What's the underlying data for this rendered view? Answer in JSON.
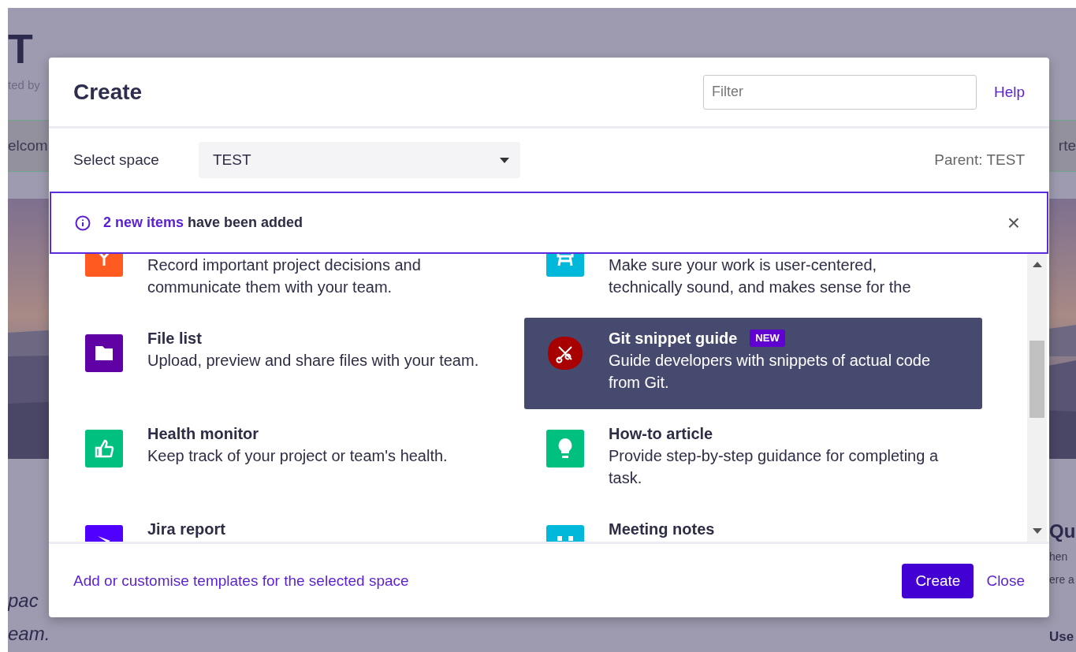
{
  "background_page": {
    "title": "T",
    "byline": "ted by",
    "nav": [
      "elcom",
      "rte"
    ],
    "left_text": [
      "pac",
      "eam."
    ],
    "right_heading": "Qu",
    "right_text": [
      "hen",
      "ere a"
    ],
    "right_heading_2": "Use"
  },
  "dialog": {
    "title": "Create",
    "filter": {
      "placeholder": "Filter"
    },
    "help": "Help",
    "space": {
      "label": "Select space",
      "value": "TEST",
      "parent": "Parent: TEST"
    },
    "banner": {
      "highlight": "2 new items",
      "text": " have been added",
      "close": "×"
    },
    "templates": [
      {
        "kind": "decision",
        "color": "#ff5a1f",
        "description": "Record important project decisions and communicate them with your team.",
        "selected": false
      },
      {
        "kind": "design",
        "color": "#00b8d9",
        "description": "Make sure your work is user-centered, technically sound, and makes sense for the",
        "selected": false
      },
      {
        "kind": "folder",
        "color": "#6001a6",
        "title": "File list",
        "description": "Upload, preview and share files with your team.",
        "selected": false
      },
      {
        "kind": "git",
        "color": "#a80000",
        "title": "Git snippet guide",
        "badge": "NEW",
        "description": "Guide developers with snippets of actual code from Git.",
        "selected": true
      },
      {
        "kind": "health",
        "color": "#00c07f",
        "title": "Health monitor",
        "description": "Keep track of your project or team's health.",
        "selected": false
      },
      {
        "kind": "howto",
        "color": "#00c07f",
        "title": "How-to article",
        "description": "Provide step-by-step guidance for completing a task.",
        "selected": false
      },
      {
        "kind": "jira",
        "color": "#5000ff",
        "title": "Jira report",
        "selected": false
      },
      {
        "kind": "meeting",
        "color": "#00b8d9",
        "title": "Meeting notes",
        "selected": false
      }
    ],
    "footer": {
      "link": "Add or customise templates for the selected space",
      "create": "Create",
      "close": "Close"
    }
  }
}
